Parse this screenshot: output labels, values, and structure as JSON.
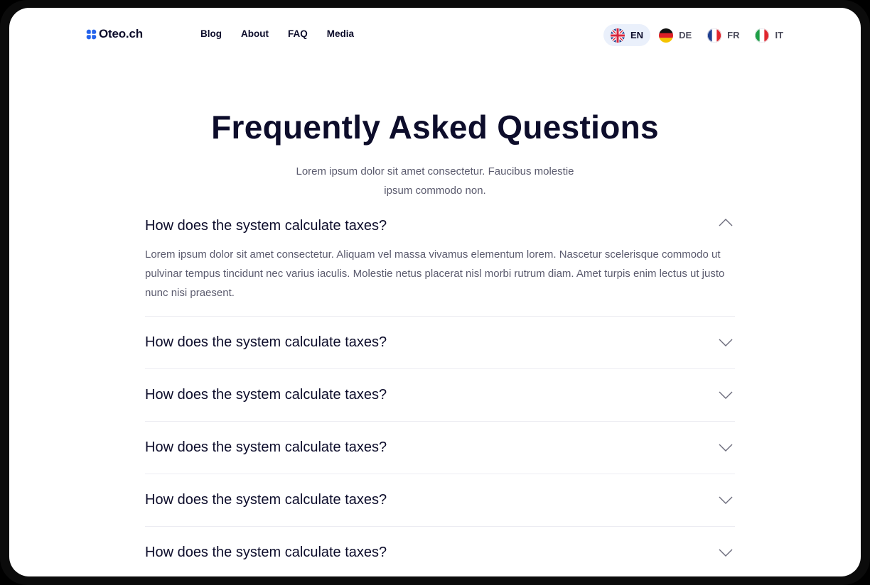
{
  "brand": {
    "name": "Oteo.ch",
    "accent": "#2563eb"
  },
  "nav": {
    "items": [
      {
        "label": "Blog"
      },
      {
        "label": "About"
      },
      {
        "label": "FAQ"
      },
      {
        "label": "Media"
      }
    ]
  },
  "languages": [
    {
      "code": "EN",
      "flag": "uk-flag-icon",
      "active": true
    },
    {
      "code": "DE",
      "flag": "germany-flag-icon",
      "active": false
    },
    {
      "code": "FR",
      "flag": "france-flag-icon",
      "active": false
    },
    {
      "code": "IT",
      "flag": "italy-flag-icon",
      "active": false
    }
  ],
  "hero": {
    "title": "Frequently Asked Questions",
    "subtitle_line1": "Lorem ipsum dolor sit amet consectetur. Faucibus molestie",
    "subtitle_line2": "ipsum commodo non."
  },
  "faq": [
    {
      "question": "How does the system calculate taxes?",
      "answer": "Lorem ipsum dolor sit amet consectetur. Aliquam vel massa vivamus elementum lorem. Nascetur scelerisque commodo ut pulvinar tempus tincidunt nec varius iaculis. Molestie netus placerat nisl morbi rutrum diam. Amet turpis enim lectus ut justo nunc nisi praesent.",
      "expanded": true
    },
    {
      "question": "How does the system calculate taxes?",
      "expanded": false
    },
    {
      "question": "How does the system calculate taxes?",
      "expanded": false
    },
    {
      "question": "How does the system calculate taxes?",
      "expanded": false
    },
    {
      "question": "How does the system calculate taxes?",
      "expanded": false
    },
    {
      "question": "How does the system calculate taxes?",
      "expanded": false
    }
  ],
  "colors": {
    "text_dark": "#0d0d2b",
    "text_muted": "#5b5b6e",
    "active_lang_bg": "#eaf0fb",
    "divider": "#ececf2"
  }
}
